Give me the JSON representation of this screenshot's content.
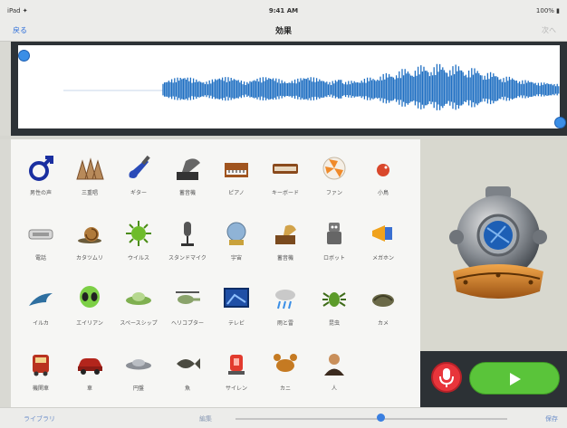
{
  "status_bar": {
    "carrier": "iPad ✦",
    "time": "9:41 AM",
    "battery": "100% ▮"
  },
  "nav": {
    "left": "戻る",
    "title": "効果",
    "right": "次へ"
  },
  "grid": {
    "rows": [
      [
        {
          "icon": "male-symbol-icon",
          "label": "男性の声"
        },
        {
          "icon": "triple-sound-icon",
          "label": "三重唱"
        },
        {
          "icon": "electric-guitar-icon",
          "label": "ギター"
        },
        {
          "icon": "gramophone-icon",
          "label": "蓄音機"
        },
        {
          "icon": "piano-icon",
          "label": "ピアノ"
        },
        {
          "icon": "keyboard-icon",
          "label": "キーボード"
        },
        {
          "icon": "fan-icon",
          "label": "ファン"
        },
        {
          "icon": "bird-icon",
          "label": "小鳥"
        }
      ],
      [
        {
          "icon": "telephone-icon",
          "label": "電話"
        },
        {
          "icon": "snail-icon",
          "label": "カタツムリ"
        },
        {
          "icon": "virus-icon",
          "label": "ウイルス"
        },
        {
          "icon": "microphone-stand-icon",
          "label": "スタンドマイク"
        },
        {
          "icon": "globe-icon",
          "label": "宇宙"
        },
        {
          "icon": "phonograph-icon",
          "label": "蓄音機"
        },
        {
          "icon": "robot-icon",
          "label": "ロボット"
        },
        {
          "icon": "megaphone-icon",
          "label": "メガホン"
        }
      ],
      [
        {
          "icon": "dolphin-icon",
          "label": "イルカ"
        },
        {
          "icon": "alien-icon",
          "label": "エイリアン"
        },
        {
          "icon": "ufo-icon",
          "label": "スペースシップ"
        },
        {
          "icon": "helicopter-icon",
          "label": "ヘリコプター"
        },
        {
          "icon": "tv-screen-icon",
          "label": "テレビ"
        },
        {
          "icon": "weather-icon",
          "label": "雨と雷"
        },
        {
          "icon": "bug-icon",
          "label": "昆虫"
        },
        {
          "icon": "turtle-icon",
          "label": "カメ"
        }
      ],
      [
        {
          "icon": "train-icon",
          "label": "機関車"
        },
        {
          "icon": "car-icon",
          "label": "車"
        },
        {
          "icon": "flying-saucer-icon",
          "label": "円盤"
        },
        {
          "icon": "fish-icon",
          "label": "魚"
        },
        {
          "icon": "siren-icon",
          "label": "サイレン"
        },
        {
          "icon": "crab-icon",
          "label": "カニ"
        },
        {
          "icon": "person-icon",
          "label": "人"
        }
      ]
    ]
  },
  "preview": {
    "icon": "diving-helmet-icon"
  },
  "controls": {
    "record": "microphone-icon",
    "play": "play-icon"
  },
  "bottom_bar": {
    "left": "ライブラリ",
    "center": "編集",
    "right": "保存"
  },
  "colors": {
    "accent": "#3a8ee6",
    "waveform": "#1f6fc2",
    "record": "#e8353b",
    "play": "#5ac43a"
  }
}
